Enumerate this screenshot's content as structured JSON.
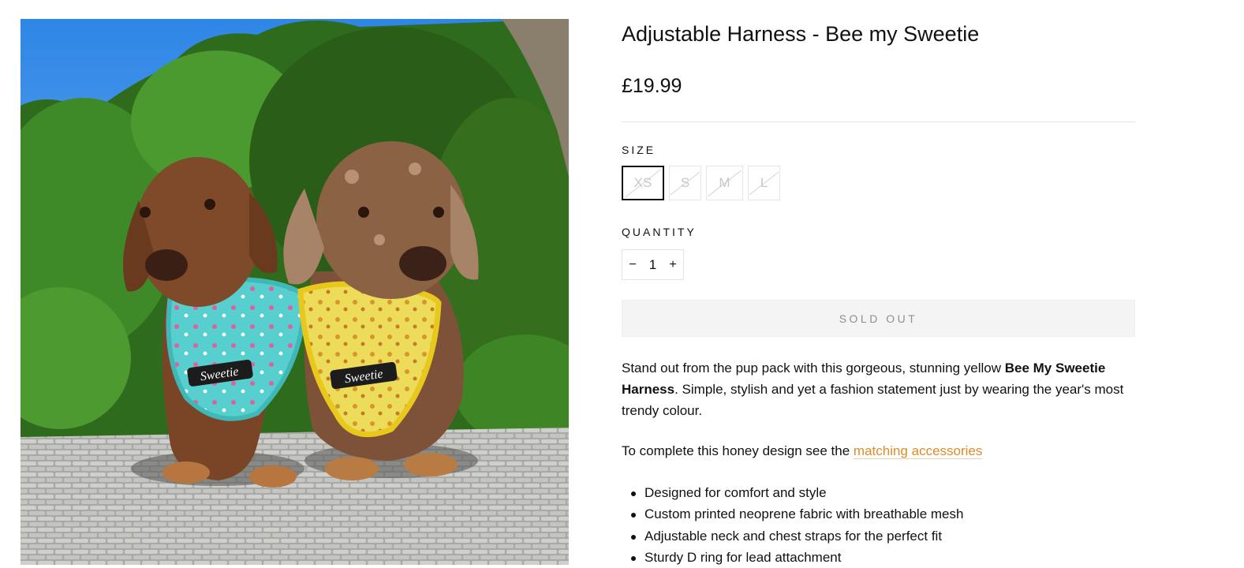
{
  "product": {
    "image_alt": "Two dachshunds wearing Sweetie harnesses",
    "harness_logo": "Sweetie",
    "title": "Adjustable Harness - Bee my Sweetie",
    "price": "£19.99"
  },
  "size": {
    "label": "SIZE",
    "options": [
      "XS",
      "S",
      "M",
      "L"
    ],
    "selected": "XS"
  },
  "quantity": {
    "label": "QUANTITY",
    "minus_icon": "−",
    "value": "1",
    "plus_icon": "+"
  },
  "cart": {
    "sold_out_label": "SOLD OUT"
  },
  "description": {
    "p1_a": "Stand out from the pup pack with this gorgeous, stunning yellow ",
    "p1_bold": "Bee My Sweetie Harness",
    "p1_b": ". Simple, stylish and yet a fashion statement just by wearing the year's most trendy colour.",
    "p2_text": "To complete this honey design see the ",
    "p2_link": "matching accessories",
    "bullets": [
      "Designed for comfort and style",
      "Custom printed neoprene fabric with breathable mesh",
      "Adjustable neck and chest straps for the perfect fit",
      "Sturdy D ring for lead attachment"
    ]
  },
  "colors": {
    "text": "#111111",
    "link": "#e08a2a",
    "sold_out_bg": "#f4f4f4"
  }
}
